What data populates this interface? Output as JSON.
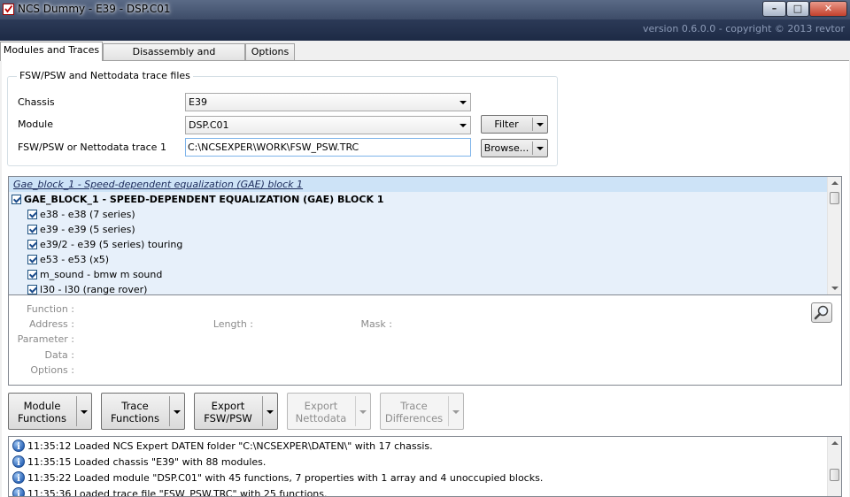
{
  "window": {
    "title": "NCS Dummy - E39 - DSP.C01",
    "min_glyph": "–",
    "max_glyph": "□",
    "close_glyph": "✕",
    "version": "version 0.6.0.0 - copyright © 2013 revtor"
  },
  "tabs": [
    {
      "label": "Modules and Traces",
      "active": true
    },
    {
      "label": "Disassembly and Checksums",
      "active": false
    },
    {
      "label": "Options",
      "active": false
    }
  ],
  "files_group": {
    "legend": "FSW/PSW and Nettodata trace files",
    "chassis_label": "Chassis",
    "chassis_value": "E39",
    "module_label": "Module",
    "module_value": "DSP.C01",
    "trace_label": "FSW/PSW or Nettodata trace 1",
    "trace_value": "C:\\NCSEXPER\\WORK\\FSW_PSW.TRC",
    "filter_label": "Filter",
    "browse_label": "Browse..."
  },
  "tree": {
    "header": "Gae_block_1  -  Speed-dependent equalization (GAE) block 1",
    "root": "GAE_BLOCK_1  -  SPEED-DEPENDENT EQUALIZATION (GAE) BLOCK 1",
    "items": [
      "e38  -  e38 (7 series)",
      "e39  -  e39 (5 series)",
      "e39/2  -  e39 (5 series) touring",
      "e53  -  e53 (x5)",
      "m_sound  -  bmw m sound",
      "l30  -  l30 (range rover)"
    ]
  },
  "details": {
    "function": "Function :",
    "address": "Address :",
    "parameter": "Parameter :",
    "data": "Data :",
    "options": "Options :",
    "length": "Length :",
    "mask": "Mask :"
  },
  "buttons": [
    {
      "line1": "Module",
      "line2": "Functions",
      "enabled": true
    },
    {
      "line1": "Trace",
      "line2": "Functions",
      "enabled": true
    },
    {
      "line1": "Export",
      "line2": "FSW/PSW",
      "enabled": true
    },
    {
      "line1": "Export",
      "line2": "Nettodata",
      "enabled": false
    },
    {
      "line1": "Trace",
      "line2": "Differences",
      "enabled": false
    }
  ],
  "log": [
    "11:35:12  Loaded NCS Expert DATEN folder \"C:\\NCSEXPER\\DATEN\\\" with 17 chassis.",
    "11:35:15  Loaded chassis \"E39\" with 88 modules.",
    "11:35:22  Loaded module \"DSP.C01\" with 45 functions, 7 properties with 1 array and 4 unoccupied blocks.",
    "11:35:36  Loaded trace file \"FSW_PSW.TRC\" with 25 functions."
  ],
  "colors": {
    "titlebar": "#4a5a78",
    "versionbar": "#24324e",
    "tree_bg": "#e7f0fa",
    "tree_header": "#cde3f7"
  }
}
